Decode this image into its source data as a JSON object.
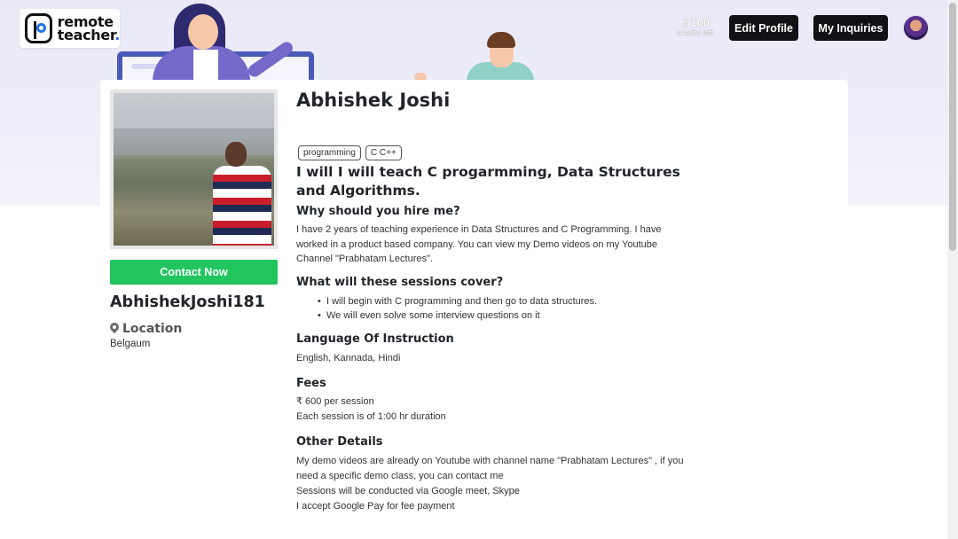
{
  "header": {
    "logo_line1": "remote",
    "logo_line2": "teacher",
    "logo_dot": ".",
    "credits_value": "100",
    "credits_label": "credits left",
    "edit_profile_label": "Edit Profile",
    "my_inquiries_label": "My Inquiries"
  },
  "sidebar": {
    "contact_label": "Contact Now",
    "username": "AbhishekJoshi181",
    "location_heading": "Location",
    "location_value": "Belgaum"
  },
  "profile": {
    "name": "Abhishek Joshi",
    "tags": [
      "programming",
      "C C++"
    ],
    "headline": "I will I will teach C progarmming, Data Structures and Algorithms.",
    "why_title": "Why should you hire me?",
    "why_text": "I have 2 years of teaching experience in Data Structures and C Programming. I have worked in a product based company. You can view my Demo videos on my Youtube Channel \"Prabhatam Lectures\".",
    "sessions_title": "What will these sessions cover?",
    "sessions_items": [
      "I will begin with C programming and then go to data structures.",
      "We will even solve some interview questions on it"
    ],
    "language_title": "Language Of Instruction",
    "language_text": "English, Kannada, Hindi",
    "fees_title": "Fees",
    "fees_line1": "₹ 600 per session",
    "fees_line2": "Each session is of 1:00 hr duration",
    "other_title": "Other Details",
    "other_line1": "My demo videos are already on Youtube with channel name \"Prabhatam Lectures\" , if you need a specific demo class, you can contact me",
    "other_line2": "Sessions will be conducted via Google meet, Skype",
    "other_line3": "I accept Google Pay for fee payment"
  },
  "icons": {
    "credits": "key-icon",
    "location": "map-pin-icon"
  },
  "colors": {
    "contact_button": "#22c55e",
    "dark_button": "#111216",
    "logo_accent": "#1f73e8"
  }
}
